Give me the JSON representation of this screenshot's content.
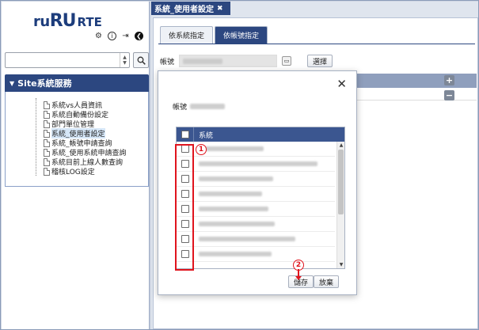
{
  "app": {
    "logo": {
      "part1": "ru",
      "part2": "RU",
      "part3": "RTE"
    },
    "toolbar_icons": [
      "gear-icon",
      "info-icon",
      "logout-icon",
      "back-icon"
    ]
  },
  "sidebar": {
    "search_placeholder": "",
    "section_title": "Site系統服務",
    "items": [
      {
        "label": "系統vs人員資訊"
      },
      {
        "label": "系統自動備份設定"
      },
      {
        "label": "部門單位管理"
      },
      {
        "label": "系統_使用者設定"
      },
      {
        "label": "系統_帳號申請查詢"
      },
      {
        "label": "系統_使用系統申請查詢"
      },
      {
        "label": "系統目前上線人數查詢"
      },
      {
        "label": "稽核LOG設定"
      }
    ]
  },
  "main": {
    "tab_title": "系統_使用者設定",
    "subtabs": [
      {
        "label": "依系統指定"
      },
      {
        "label": "依帳號指定"
      }
    ],
    "account_label": "帳號",
    "select_button": "選擇"
  },
  "modal": {
    "account_label": "帳號",
    "grid_header": "系統",
    "row_count": 8,
    "save_button": "儲存",
    "cancel_button": "放棄"
  },
  "annotations": {
    "marker1": "1",
    "marker2": "2",
    "color": "#e0141d"
  },
  "colors": {
    "primary": "#2c4780",
    "accent_red": "#e0141d"
  }
}
